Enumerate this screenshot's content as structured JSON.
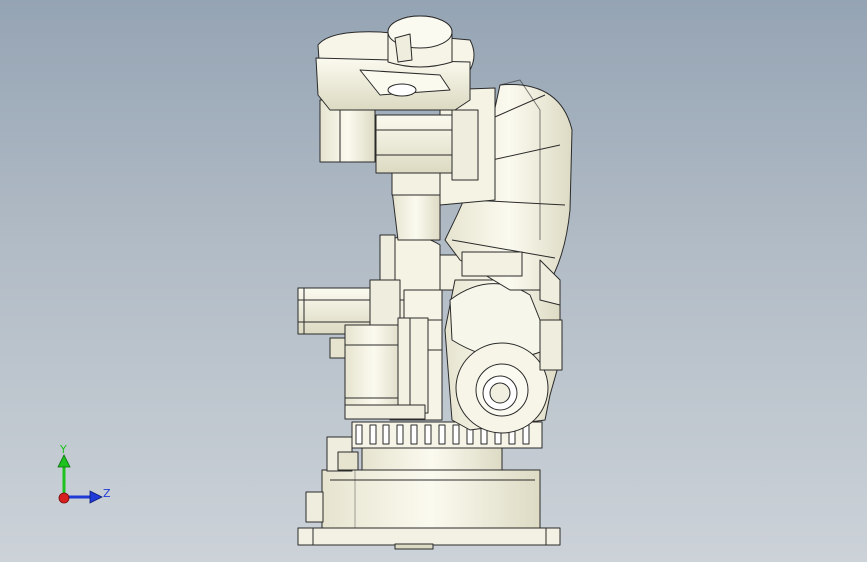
{
  "viewport": {
    "background_top": "#95a4b4",
    "background_bottom": "#ccd2d8",
    "model_fill": "#f5f4e6",
    "model_shade": "#e2e0cc",
    "edge_color": "#2a2a2a"
  },
  "triad": {
    "y_label": "Y",
    "z_label": "Z",
    "y_color": "#1ec21e",
    "z_color": "#1f3ad6",
    "x_color": "#d61f1f"
  }
}
